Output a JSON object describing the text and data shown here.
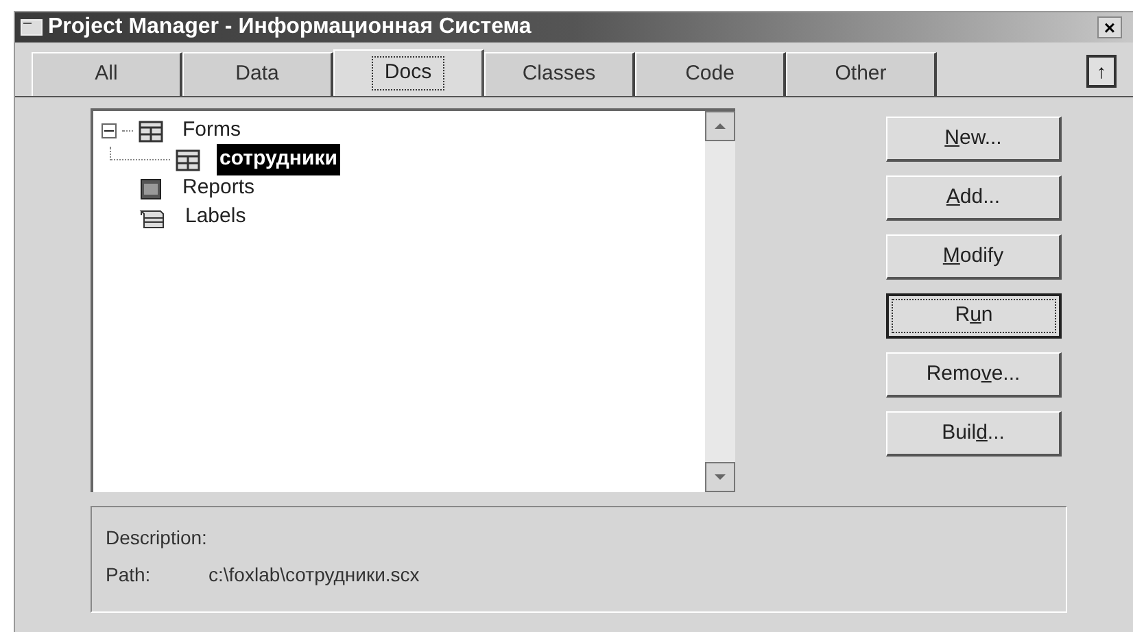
{
  "window": {
    "title": "Project Manager - Информационная Система",
    "close": "×"
  },
  "tabs": [
    {
      "label": "All",
      "selected": false
    },
    {
      "label": "Data",
      "selected": false
    },
    {
      "label": "Docs",
      "selected": true
    },
    {
      "label": "Classes",
      "selected": false
    },
    {
      "label": "Code",
      "selected": false
    },
    {
      "label": "Other",
      "selected": false
    }
  ],
  "collapse_toggle": "↑",
  "tree": [
    {
      "label": "Forms",
      "kind": "form",
      "expanded": true,
      "selected": false,
      "children": [
        {
          "label": "сотрудники",
          "kind": "form",
          "selected": true
        }
      ]
    },
    {
      "label": "Reports",
      "kind": "report",
      "selected": false
    },
    {
      "label": "Labels",
      "kind": "label",
      "selected": false
    }
  ],
  "buttons": [
    {
      "key": "N",
      "post": "ew...",
      "focused": false
    },
    {
      "key": "A",
      "post": "dd...",
      "focused": false
    },
    {
      "key": "M",
      "post": "odify",
      "focused": false
    },
    {
      "pre": "R",
      "key": "u",
      "post": "n",
      "focused": true
    },
    {
      "pre": "Remo",
      "key": "v",
      "post": "e...",
      "focused": false
    },
    {
      "pre": "Buil",
      "key": "d",
      "post": "...",
      "focused": false
    }
  ],
  "info": {
    "description_label": "Description:",
    "path_label": "Path:",
    "path": "c:\\foxlab\\сотрудники.scx"
  }
}
